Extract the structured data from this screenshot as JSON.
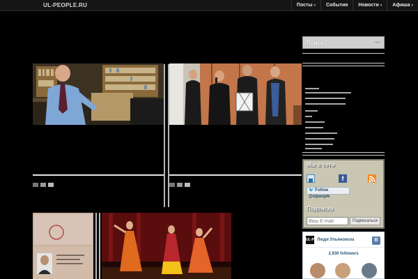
{
  "site": {
    "logo": "UL-PEOPLE.RU"
  },
  "nav": [
    {
      "label": "Посты",
      "has_dropdown": true
    },
    {
      "label": "События",
      "has_dropdown": false
    },
    {
      "label": "Новости",
      "has_dropdown": true
    },
    {
      "label": "Афиша",
      "has_dropdown": true
    }
  ],
  "sidebar": {
    "search_label": "Поиск",
    "search_btn": "—",
    "social_title": "Мы в сети",
    "follow_label": "Follow @ulpeople",
    "subscribe_title": "Подписка",
    "email_placeholder": "Ваш E-mail",
    "subscribe_button": "Подписаться"
  },
  "vk": {
    "logo": "UL-P",
    "name": "Люди Ульяновска",
    "button": "В",
    "followers": "2,930 followers"
  },
  "colors": {
    "background": "#000000",
    "vk_blue": "#5b7fa6",
    "twitter": "#1da1f2",
    "facebook": "#3b5998",
    "rss": "#f2892b"
  }
}
